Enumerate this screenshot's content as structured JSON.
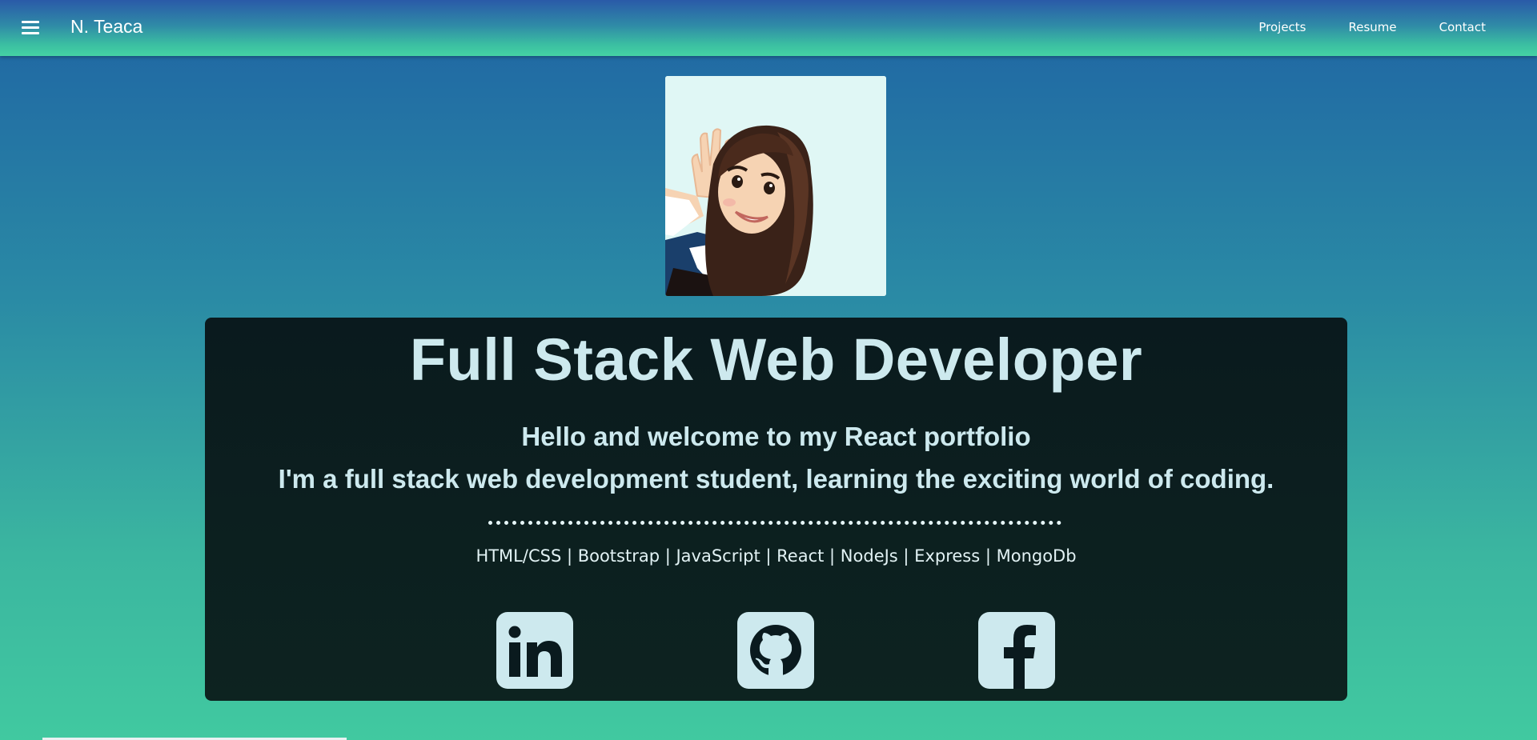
{
  "navbar": {
    "brand": "N. Teaca",
    "links": [
      "Projects",
      "Resume",
      "Contact"
    ]
  },
  "hero": {
    "title": "Full Stack Web Developer",
    "greeting": "Hello and welcome to my React portfolio",
    "intro": "I'm a full stack web development student, learning the exciting world of coding.",
    "skills": "HTML/CSS | Bootstrap | JavaScript | React | NodeJs | Express | MongoDb"
  },
  "social": [
    {
      "name": "linkedin-icon"
    },
    {
      "name": "github-icon"
    },
    {
      "name": "facebook-icon"
    }
  ],
  "colors": {
    "accent_text": "#cde9ee",
    "card_bg": "#0b1c1e",
    "avatar_bg": "#e0f7f5"
  }
}
